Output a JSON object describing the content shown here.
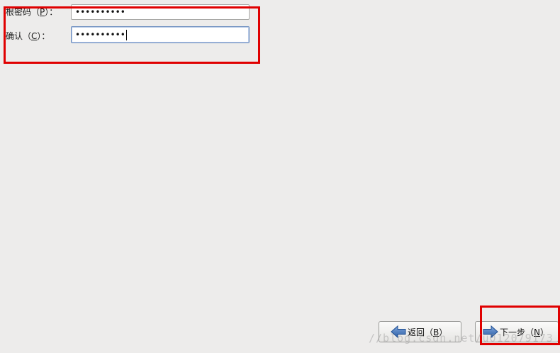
{
  "form": {
    "root_password": {
      "label_prefix": "根密码（",
      "mnemonic": "P",
      "label_suffix": "）：",
      "masked_value": "••••••••••"
    },
    "confirm_password": {
      "label_prefix": "确认（",
      "mnemonic": "C",
      "label_suffix": "）：",
      "masked_value": "••••••••••"
    }
  },
  "buttons": {
    "back": {
      "label_prefix": "返回（",
      "mnemonic": "B",
      "label_suffix": "）",
      "icon": "arrow-left-icon"
    },
    "next": {
      "label_prefix": "下一步（",
      "mnemonic": "N",
      "label_suffix": "）",
      "icon": "arrow-right-icon"
    }
  },
  "watermark": "//blog.csdn.net/u012079173",
  "colors": {
    "background": "#edeceb",
    "highlight_box": "#e00000",
    "arrow_icon": "#3d6fb6",
    "focus_border": "#6e8fc0"
  }
}
